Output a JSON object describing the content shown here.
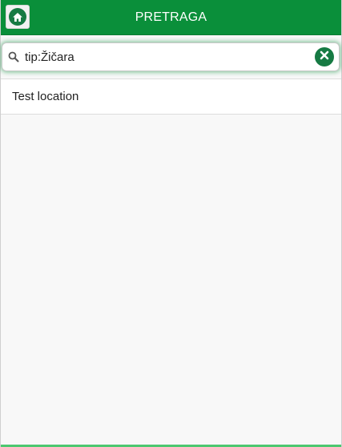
{
  "header": {
    "title": "PRETRAGA",
    "home_icon": "home-icon",
    "accent_color": "#0a8f3a"
  },
  "search": {
    "value": "tip:Žičara",
    "placeholder": "",
    "search_icon": "search-icon",
    "clear_icon": "clear-icon"
  },
  "results": {
    "items": [
      {
        "label": "Test location"
      }
    ]
  }
}
